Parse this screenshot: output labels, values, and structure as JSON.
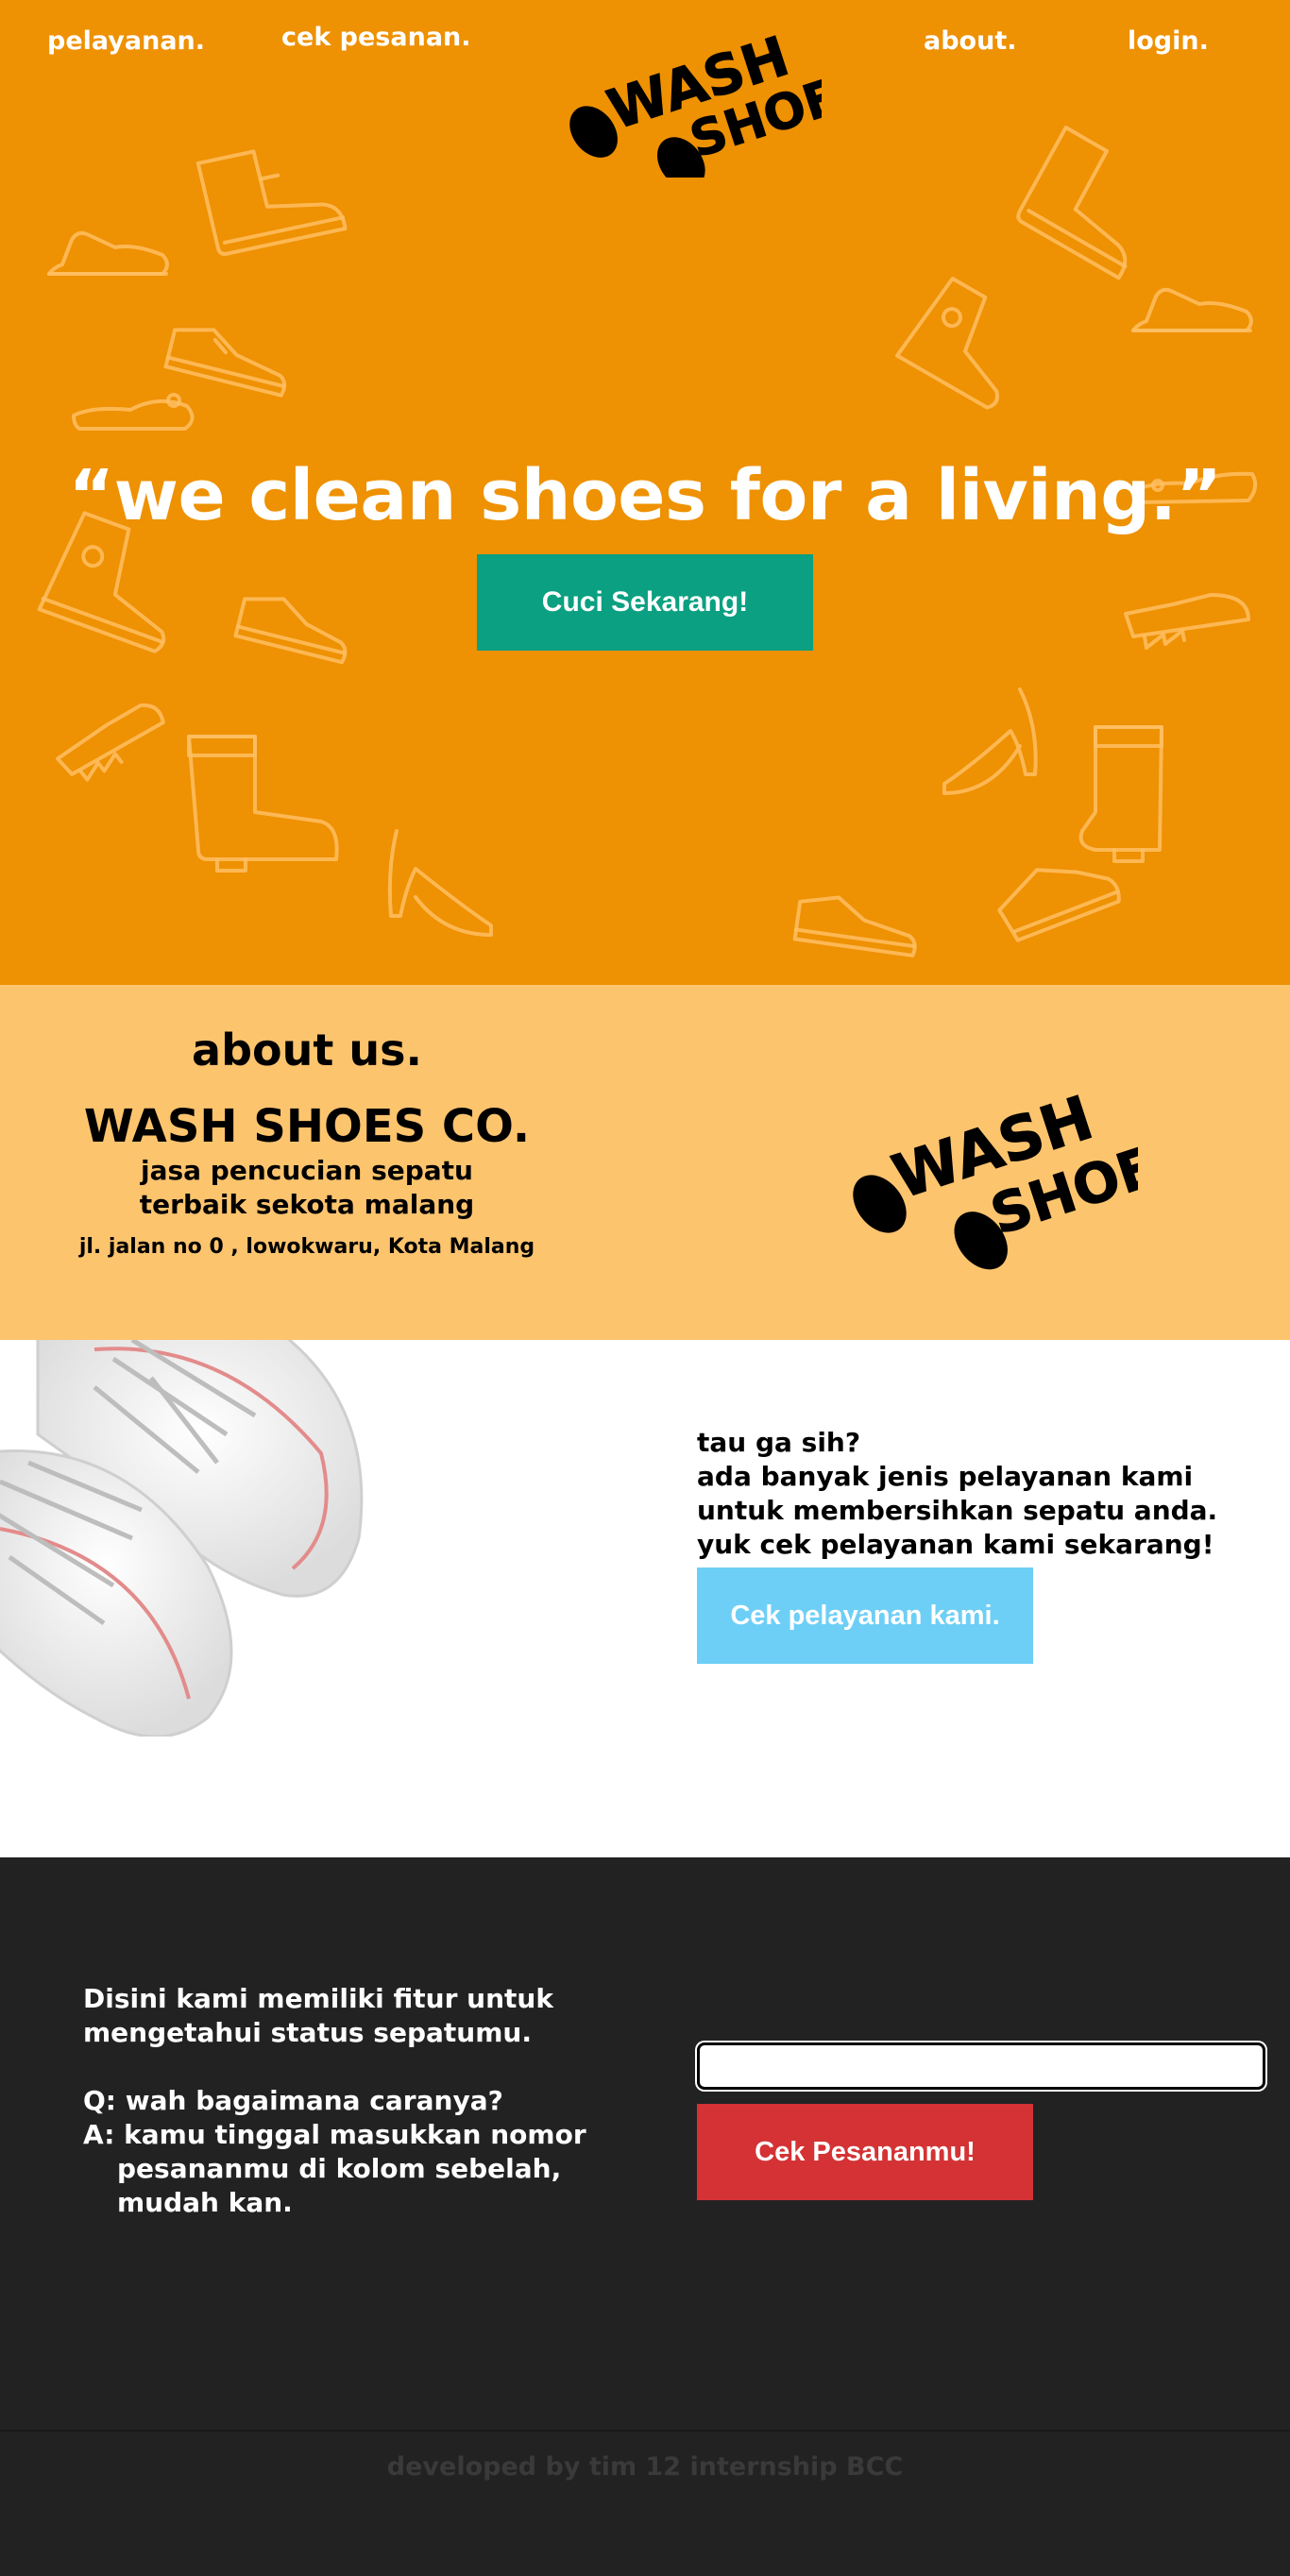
{
  "nav": {
    "pelayanan": "pelayanan.",
    "cek_pesanan": "cek pesanan.",
    "about": "about.",
    "login": "login."
  },
  "logo": {
    "line1": "WASH",
    "line2": "SHOES"
  },
  "hero": {
    "tagline": "“we clean shoes for a living.”",
    "cta_label": "Cuci Sekarang!"
  },
  "about": {
    "heading": "about us.",
    "company": "WASH SHOES CO.",
    "desc_line1": "jasa pencucian sepatu",
    "desc_line2": "terbaik sekota malang",
    "address": "jl. jalan no 0 , lowokwaru, Kota Malang"
  },
  "services": {
    "line1": "tau ga sih?",
    "line2": "ada banyak jenis pelayanan kami",
    "line3": "untuk membersihkan sepatu anda.",
    "line4": "yuk cek pelayanan kami sekarang!",
    "button_label": "Cek pelayanan kami."
  },
  "order": {
    "line1": "Disini kami memiliki fitur untuk",
    "line2": "mengetahui status sepatumu.",
    "question": "Q: wah bagaimana caranya?",
    "answer_line1": "A: kamu tinggal masukkan nomor",
    "answer_line2": "pesananmu di kolom sebelah,",
    "answer_line3": "mudah kan.",
    "input_value": "",
    "button_label": "Cek Pesananmu!"
  },
  "footer": {
    "text": "developed by tim 12 internship BCC"
  },
  "colors": {
    "hero_bg": "#EE9102",
    "about_bg": "#FDC46E",
    "cta_green": "#0BA081",
    "services_blue": "#6ECFF6",
    "order_red": "#D43234",
    "dark_bg": "#232223"
  }
}
